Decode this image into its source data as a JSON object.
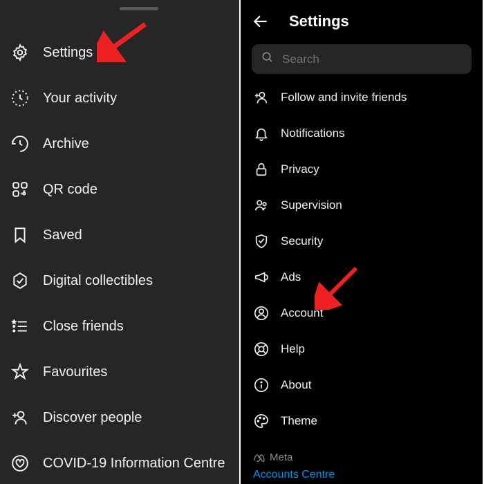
{
  "leftPanel": {
    "items": [
      {
        "label": "Settings"
      },
      {
        "label": "Your activity"
      },
      {
        "label": "Archive"
      },
      {
        "label": "QR code"
      },
      {
        "label": "Saved"
      },
      {
        "label": "Digital collectibles"
      },
      {
        "label": "Close friends"
      },
      {
        "label": "Favourites"
      },
      {
        "label": "Discover people"
      },
      {
        "label": "COVID-19 Information Centre"
      }
    ]
  },
  "rightPanel": {
    "title": "Settings",
    "search": {
      "placeholder": "Search"
    },
    "items": [
      {
        "label": "Follow and invite friends"
      },
      {
        "label": "Notifications"
      },
      {
        "label": "Privacy"
      },
      {
        "label": "Supervision"
      },
      {
        "label": "Security"
      },
      {
        "label": "Ads"
      },
      {
        "label": "Account"
      },
      {
        "label": "Help"
      },
      {
        "label": "About"
      },
      {
        "label": "Theme"
      }
    ],
    "meta": {
      "brand": "Meta",
      "link": "Accounts Centre"
    }
  }
}
